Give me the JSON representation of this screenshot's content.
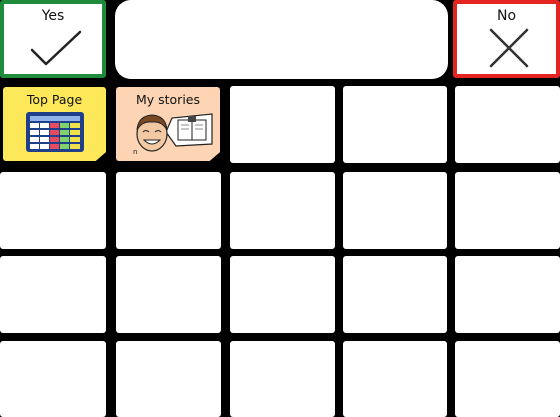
{
  "yes_button": {
    "label": "Yes",
    "icon": "checkmark-icon",
    "border_color": "#1e8c3a"
  },
  "no_button": {
    "label": "No",
    "icon": "cross-icon",
    "border_color": "#e32420"
  },
  "message_bar": {
    "text": ""
  },
  "symbols": [
    {
      "label": "Top Page",
      "icon": "grid-board-icon",
      "background": "#fde85a"
    },
    {
      "label": "My stories",
      "icon": "person-reading-book-icon",
      "background": "#fdd5b4"
    }
  ],
  "grid": {
    "rows": 4,
    "columns": 5
  }
}
